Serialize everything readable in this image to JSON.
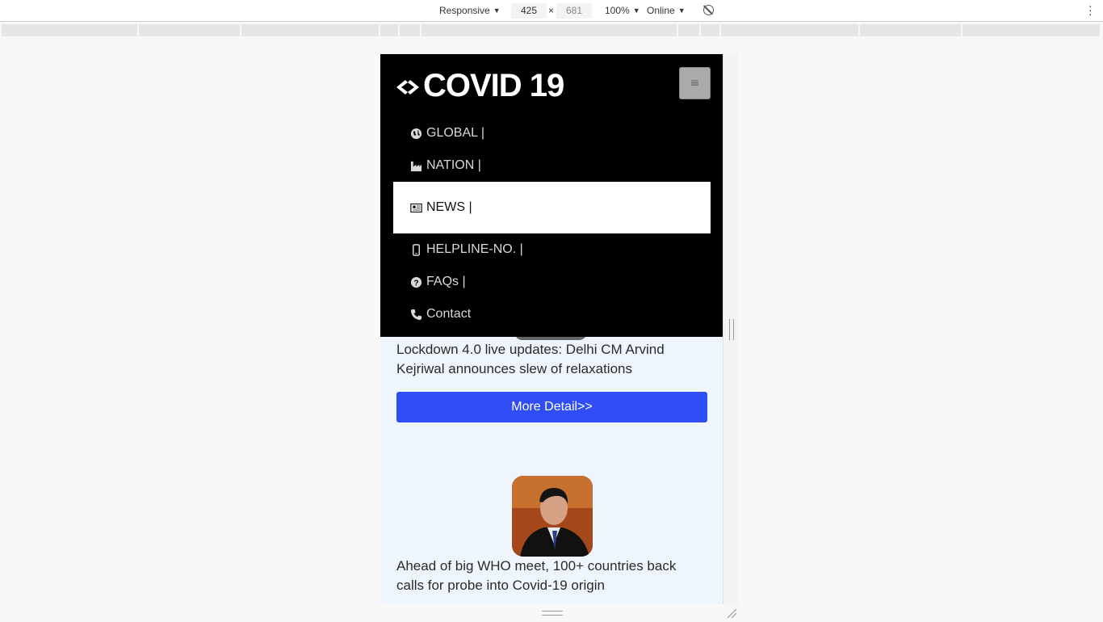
{
  "devtools": {
    "device": "Responsive",
    "width": "425",
    "times": "×",
    "height": "681",
    "zoom": "100%",
    "network": "Online"
  },
  "site": {
    "brand": "COVID 19",
    "nav": [
      {
        "label": "GLOBAL |",
        "icon": "globe-icon",
        "active": false
      },
      {
        "label": "NATION |",
        "icon": "industry-icon",
        "active": false
      },
      {
        "label": "NEWS |",
        "icon": "newspaper-icon",
        "active": true
      },
      {
        "label": "HELPLINE-NO. |",
        "icon": "mobile-icon",
        "active": false
      },
      {
        "label": "FAQs |",
        "icon": "question-circle-icon",
        "active": false
      },
      {
        "label": "Contact",
        "icon": "phone-icon",
        "active": false
      }
    ],
    "news": [
      {
        "headline": "Lockdown 4.0 live updates: Delhi CM Arvind Kejriwal announces slew of relaxations",
        "button": "More Detail>>"
      },
      {
        "headline": "Ahead of big WHO meet, 100+ countries back calls for probe into Covid-19 origin"
      }
    ]
  },
  "colors": {
    "navbar_bg": "#000000",
    "button_bg": "#2f4ef5",
    "page_bg": "#eef5fc"
  }
}
